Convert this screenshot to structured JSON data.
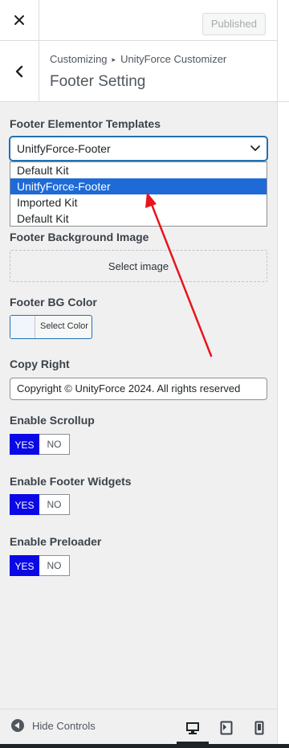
{
  "topbar": {
    "close_label": "Close",
    "publish_label": "Published"
  },
  "header": {
    "breadcrumb_root": "Customizing",
    "breadcrumb_section": "UnityForce Customizer",
    "title": "Footer Setting"
  },
  "controls": {
    "templates_label": "Footer Elementor Templates",
    "templates_selected": "UnitfyForce-Footer",
    "templates_options": [
      "Default Kit",
      "UnitfyForce-Footer",
      "Imported Kit",
      "Default Kit"
    ],
    "bg_image_label": "Footer Background Image",
    "select_image": "Select image",
    "bg_color_label": "Footer BG Color",
    "select_color": "Select Color",
    "copyright_label": "Copy Right",
    "copyright_value": "Copyright © UnityForce 2024. All rights reserved",
    "scrollup_label": "Enable Scrollup",
    "widgets_label": "Enable Footer Widgets",
    "preloader_label": "Enable Preloader",
    "yes": "YES",
    "no": "NO"
  },
  "footer": {
    "hide_controls": "Hide Controls",
    "devices": [
      "desktop-icon",
      "tablet-icon",
      "mobile-icon"
    ],
    "active_device": "desktop"
  },
  "colors": {
    "toggle_active": "#0a08e6",
    "selected_option": "#1e6ad6",
    "annotation_arrow": "#e8141b"
  }
}
